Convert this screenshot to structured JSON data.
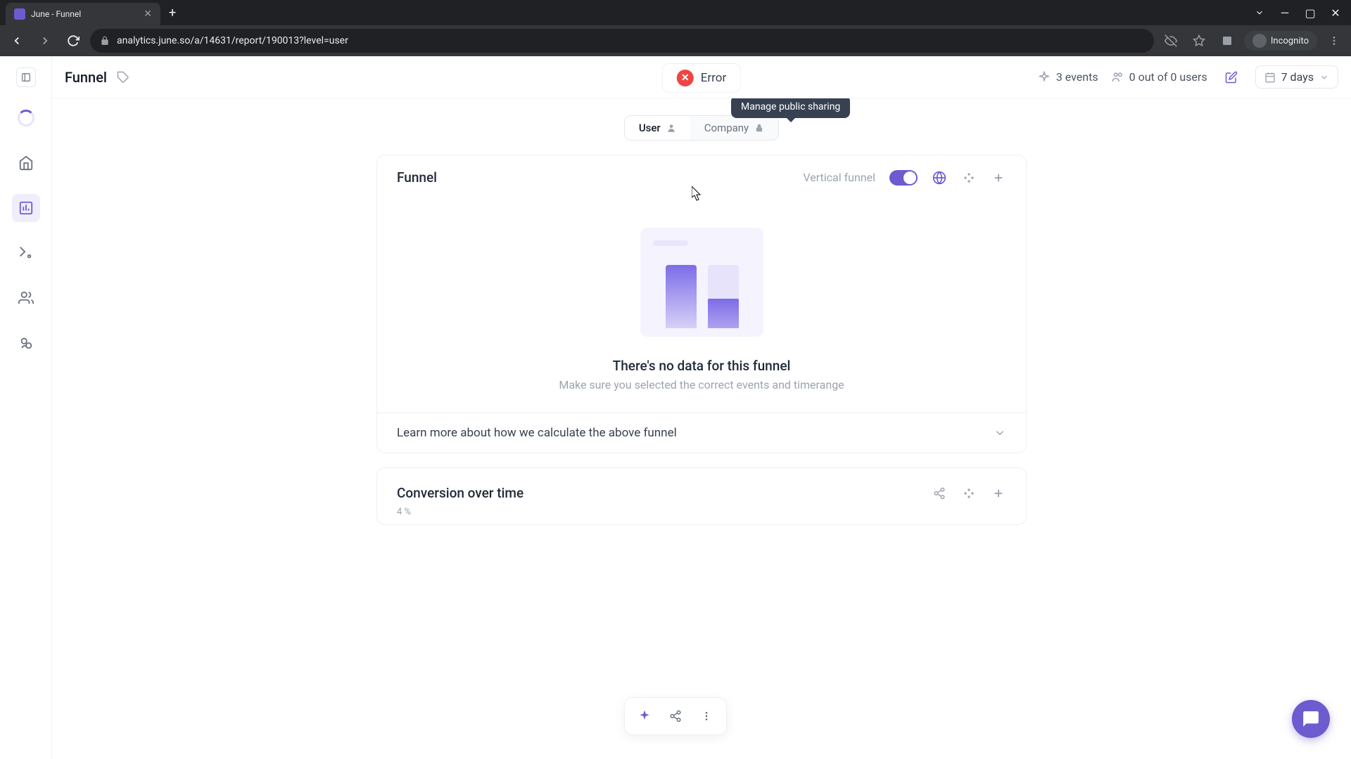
{
  "browser": {
    "tab_title": "June - Funnel",
    "url": "analytics.june.so/a/14631/report/190013?level=user",
    "incognito_label": "Incognito"
  },
  "topbar": {
    "title": "Funnel",
    "error_label": "Error",
    "events_label": "3 events",
    "users_label": "0 out of 0 users",
    "date_label": "7 days"
  },
  "segments": {
    "user": "User",
    "company": "Company"
  },
  "tooltip": {
    "manage_sharing": "Manage public sharing"
  },
  "funnel_card": {
    "title": "Funnel",
    "toggle_label": "Vertical funnel",
    "empty_title": "There's no data for this funnel",
    "empty_sub": "Make sure you selected the correct events and timerange",
    "learn_more": "Learn more about how we calculate the above funnel"
  },
  "cot_card": {
    "title": "Conversion over time",
    "axis_label": "4 %"
  }
}
